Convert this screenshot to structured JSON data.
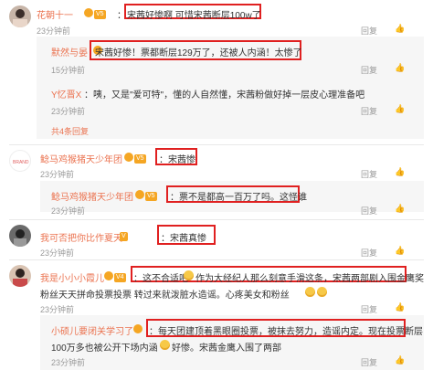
{
  "c1": {
    "name": "花朝十一",
    "text_pre": "：",
    "text_hl": "宋茜好惨啊 可惜宋茜断层100w了",
    "time": "23分钟前",
    "reply": "回复"
  },
  "c1r1": {
    "name": "默然与晏",
    "text_hl": "宋茜好惨！票都断层129万了，还被人内涵！太惨了",
    "time": "15分钟前",
    "reply": "回复"
  },
  "c1r2": {
    "name": "Y忆晋X",
    "text": "：咦，又是\"爱可特\"，懂的人自然懂，宋茜粉做好掉一层皮心理准备吧",
    "time": "23分钟前",
    "reply": "回复"
  },
  "c1more": "共4条回复",
  "c2": {
    "name": "鲶马鸡猴猪天少年团",
    "text_hl": "：宋茜惨",
    "time": "23分钟前",
    "reply": "回复"
  },
  "c2r1": {
    "name": "鲶马鸡猴猪天少年团",
    "text_hl": "：票不是都高一百万了吗。这怪谁",
    "time": "23分钟前",
    "reply": "回复"
  },
  "c3": {
    "name": "我可否把你比作夏天",
    "text_hl": "：宋茜真惨",
    "time": "23分钟前",
    "reply": "回复"
  },
  "c4": {
    "name": "我是小小小霞儿",
    "line1_hl": "：这不合适吧",
    "line1_rest": "作为大经纪人那么刻意手滑这条，宋茜两部剧入围金鹰奖",
    "line2": "粉丝天天拼命投票投票 转过来就泼脏水造谣。心疼美女和粉丝",
    "time": "23分钟前",
    "reply": "回复"
  },
  "c4r1": {
    "name": "小硕儿要闭关学习了",
    "line1": "：每天团建顶着黑眼圈投票，被抹去努力，造谣内定。现在投票断层",
    "line2": "100万多也被公开下场内涵",
    "line2_rest": "好惨。宋茜金鹰入围了两部",
    "time": "23分钟前",
    "reply": "回复"
  },
  "colors": {
    "accent": "#eb7350",
    "highlight": "#e02020",
    "vip": "#f5a623"
  }
}
